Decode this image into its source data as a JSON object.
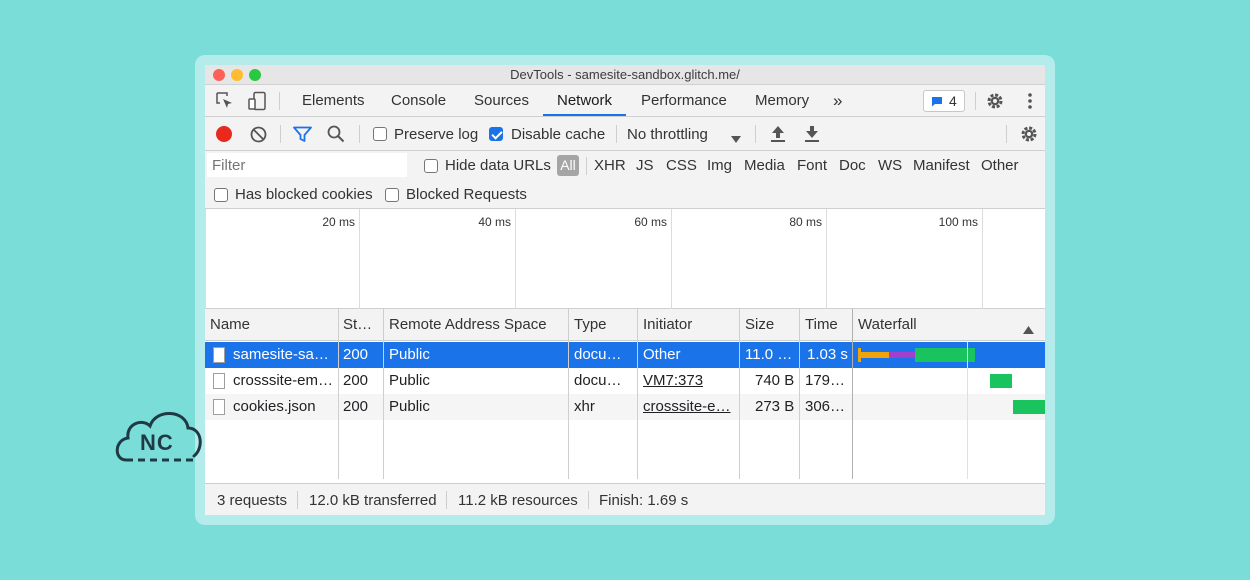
{
  "window": {
    "title": "DevTools - samesite-sandbox.glitch.me/"
  },
  "tabs": [
    {
      "label": "Elements"
    },
    {
      "label": "Console"
    },
    {
      "label": "Sources"
    },
    {
      "label": "Network",
      "active": true
    },
    {
      "label": "Performance"
    },
    {
      "label": "Memory"
    }
  ],
  "more_tabs_label": "»",
  "issues_badge": {
    "count": "4"
  },
  "toolbar": {
    "preserve_log_label": "Preserve log",
    "preserve_log_checked": false,
    "disable_cache_label": "Disable cache",
    "disable_cache_checked": true,
    "throttling_value": "No throttling"
  },
  "filter": {
    "placeholder": "Filter",
    "hide_data_urls_label": "Hide data URLs",
    "all_label": "All",
    "types": [
      "XHR",
      "JS",
      "CSS",
      "Img",
      "Media",
      "Font",
      "Doc",
      "WS",
      "Manifest",
      "Other"
    ],
    "has_blocked_cookies_label": "Has blocked cookies",
    "blocked_requests_label": "Blocked Requests"
  },
  "overview": {
    "ticks": [
      "20 ms",
      "40 ms",
      "60 ms",
      "80 ms",
      "100 ms"
    ]
  },
  "table": {
    "columns": {
      "name": "Name",
      "status": "St…",
      "remote": "Remote Address Space",
      "type": "Type",
      "initiator": "Initiator",
      "size": "Size",
      "time": "Time",
      "waterfall": "Waterfall"
    },
    "rows": [
      {
        "name": "samesite-sa…",
        "status": "200",
        "remote": "Public",
        "type": "docu…",
        "initiator": "Other",
        "size": "11.0 …",
        "time": "1.03 s"
      },
      {
        "name": "crosssite-em…",
        "status": "200",
        "remote": "Public",
        "type": "docu…",
        "initiator": "VM7:373",
        "size": "740 B",
        "time": "179…"
      },
      {
        "name": "cookies.json",
        "status": "200",
        "remote": "Public",
        "type": "xhr",
        "initiator": "crosssite-e…",
        "size": "273 B",
        "time": "306…"
      }
    ]
  },
  "status": {
    "requests": "3 requests",
    "transferred": "12.0 kB transferred",
    "resources": "11.2 kB resources",
    "finish": "Finish: 1.69 s"
  },
  "logo": {
    "text": "NC"
  },
  "colors": {
    "background": "#7bddd8",
    "accent": "#1a73e8",
    "arrow": "#ff1a1a",
    "record": "#e8291c",
    "waterfall_green": "#19c35d",
    "waterfall_orange": "#f0a30a",
    "waterfall_purple": "#a33fcf"
  }
}
